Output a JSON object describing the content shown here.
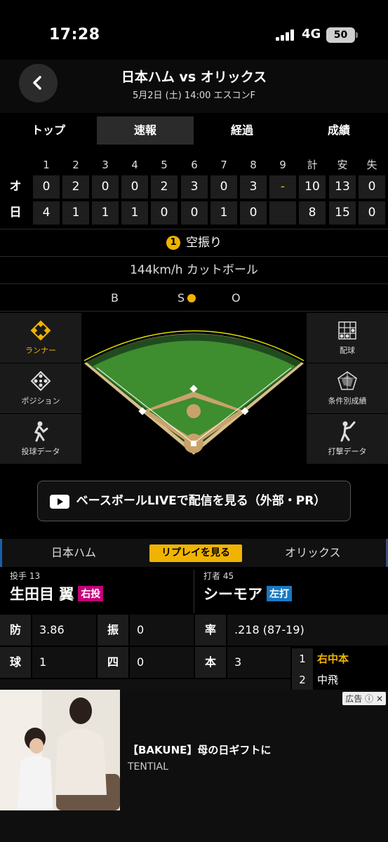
{
  "status": {
    "time": "17:28",
    "network": "4G",
    "battery": "50"
  },
  "header": {
    "title": "日本ハム vs オリックス",
    "subtitle": "5月2日 (土) 14:00 エスコンF"
  },
  "tabs": [
    "トップ",
    "速報",
    "経過",
    "成績"
  ],
  "scoreboard": {
    "columns": [
      "1",
      "2",
      "3",
      "4",
      "5",
      "6",
      "7",
      "8",
      "9",
      "計",
      "安",
      "失"
    ],
    "rows": [
      {
        "team": "オ",
        "cells": [
          "0",
          "2",
          "0",
          "0",
          "2",
          "3",
          "0",
          "3",
          "-",
          "10",
          "13",
          "0"
        ]
      },
      {
        "team": "日",
        "cells": [
          "4",
          "1",
          "1",
          "1",
          "0",
          "0",
          "1",
          "0",
          "",
          "8",
          "15",
          "0"
        ]
      }
    ]
  },
  "pitch": {
    "count": "1",
    "result": "空振り",
    "speed_type": "144km/h カットボール",
    "b": "B",
    "s": "S",
    "o": "O"
  },
  "side_buttons": {
    "runner": "ランナー",
    "position": "ポジション",
    "pitch_data": "投球データ",
    "pitch_chart": "配球",
    "conditional": "条件別成績",
    "bat_data": "打撃データ"
  },
  "live_button": "ベースボールLIVEで配信を見る（外部・PR）",
  "teambar": {
    "home": "日本ハム",
    "replay": "リプレイを見る",
    "away": "オリックス"
  },
  "pitcher": {
    "role": "投手 13",
    "name": "生田目 翼",
    "hand": "右投",
    "hand_color": "#c5007a"
  },
  "batter": {
    "role": "打者 45",
    "name": "シーモア",
    "hand": "左打",
    "hand_color": "#1a78c2"
  },
  "pitcher_stats": [
    {
      "label": "防",
      "value": "3.86"
    },
    {
      "label": "振",
      "value": "0"
    },
    {
      "label": "球",
      "value": "1"
    },
    {
      "label": "四",
      "value": "0"
    }
  ],
  "batter_stats": [
    {
      "label": "率",
      "value": ".218 (87-19)"
    },
    {
      "label": "本",
      "value": "3"
    }
  ],
  "at_bats": [
    {
      "n": "1",
      "result": "右中本",
      "color": "#f0b400"
    },
    {
      "n": "2",
      "result": "中飛",
      "color": "#ddd"
    }
  ],
  "ad": {
    "title": "【BAKUNE】母の日ギフトに",
    "brand": "TENTIAL",
    "label": "広告"
  }
}
